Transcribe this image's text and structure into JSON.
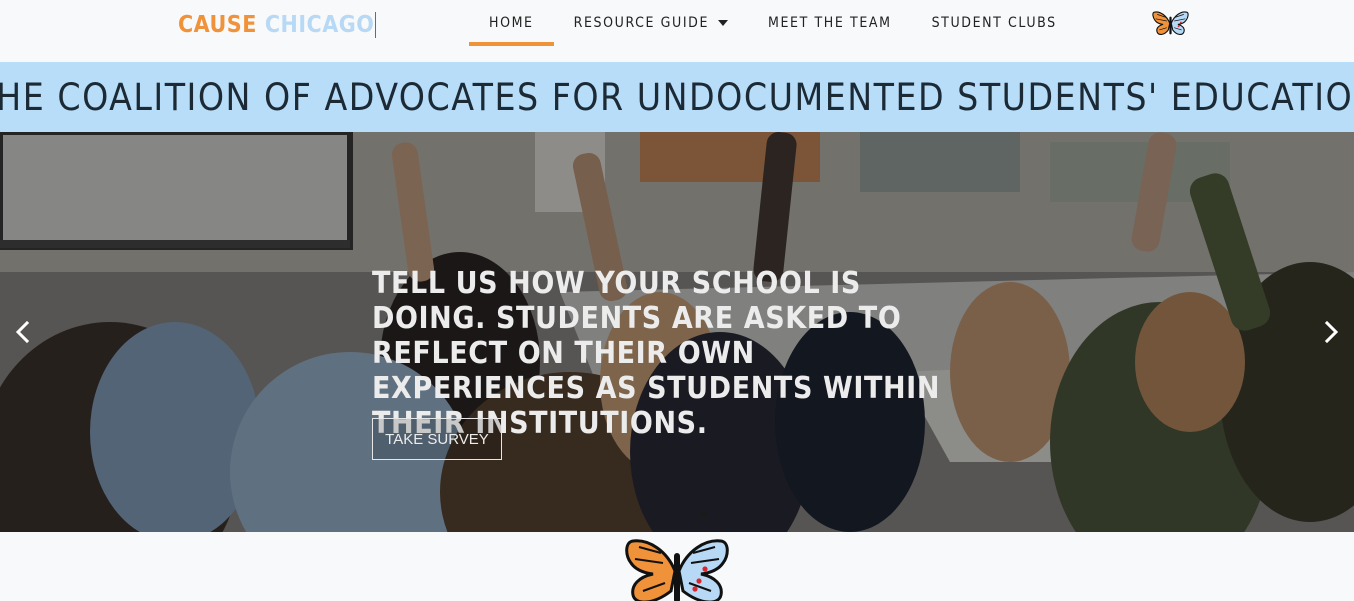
{
  "brand": {
    "word1": "CAUSE",
    "word2": "CHICAGO"
  },
  "nav": {
    "items": [
      {
        "label": "HOME",
        "active": true
      },
      {
        "label": "RESOURCE GUIDE",
        "dropdown": true
      },
      {
        "label": "MEET THE TEAM"
      },
      {
        "label": "STUDENT CLUBS"
      }
    ],
    "logo_icon": "butterfly-icon"
  },
  "banner": {
    "title": "THE COALITION OF ADVOCATES FOR UNDOCUMENTED STUDENTS' EDUCATION"
  },
  "hero": {
    "headline": "TELL US HOW YOUR SCHOOL IS DOING. STUDENTS ARE ASKED TO REFLECT ON THEIR OWN EXPERIENCES AS STUDENTS WITHIN THEIR INSTITUTIONS.",
    "button_label": "TAKE SURVEY",
    "prev_icon": "chevron-left-icon",
    "next_icon": "chevron-right-icon"
  },
  "colors": {
    "accent": "#f0923a",
    "banner": "#b8ddf8",
    "brand_blue": "#b7d9f5"
  }
}
